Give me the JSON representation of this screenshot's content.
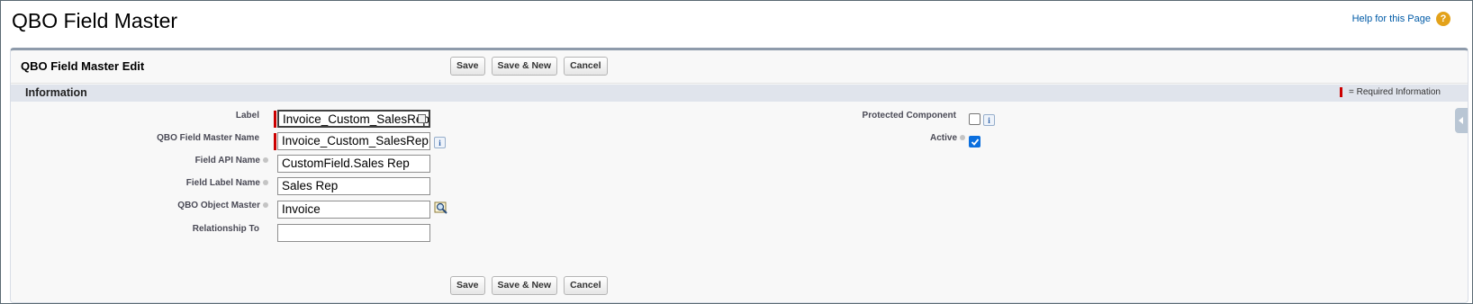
{
  "page": {
    "title": "QBO Field Master",
    "help_link": "Help for this Page",
    "help_icon": "question-circle-icon"
  },
  "panel": {
    "title": "QBO Field Master Edit",
    "buttons": {
      "save": "Save",
      "save_new": "Save & New",
      "cancel": "Cancel"
    }
  },
  "section": {
    "title": "Information",
    "required_legend": "= Required Information",
    "required_color": "#cc0000"
  },
  "fields": {
    "label": {
      "label": "Label",
      "value": "Invoice_Custom_SalesRep",
      "required": true
    },
    "name": {
      "label": "QBO Field Master Name",
      "value": "Invoice_Custom_SalesRep",
      "required": true
    },
    "api_name": {
      "label": "Field API Name",
      "value": "CustomField.Sales Rep"
    },
    "label_name": {
      "label": "Field Label Name",
      "value": "Sales Rep"
    },
    "object_master": {
      "label": "QBO Object Master",
      "value": "Invoice"
    },
    "relationship": {
      "label": "Relationship To",
      "value": ""
    },
    "protected": {
      "label": "Protected Component",
      "checked": false
    },
    "active": {
      "label": "Active",
      "checked": true
    }
  },
  "colors": {
    "accent": "#0b6fde",
    "section_bg": "#e0e4ec",
    "panel_top_border": "#8e9bab"
  }
}
